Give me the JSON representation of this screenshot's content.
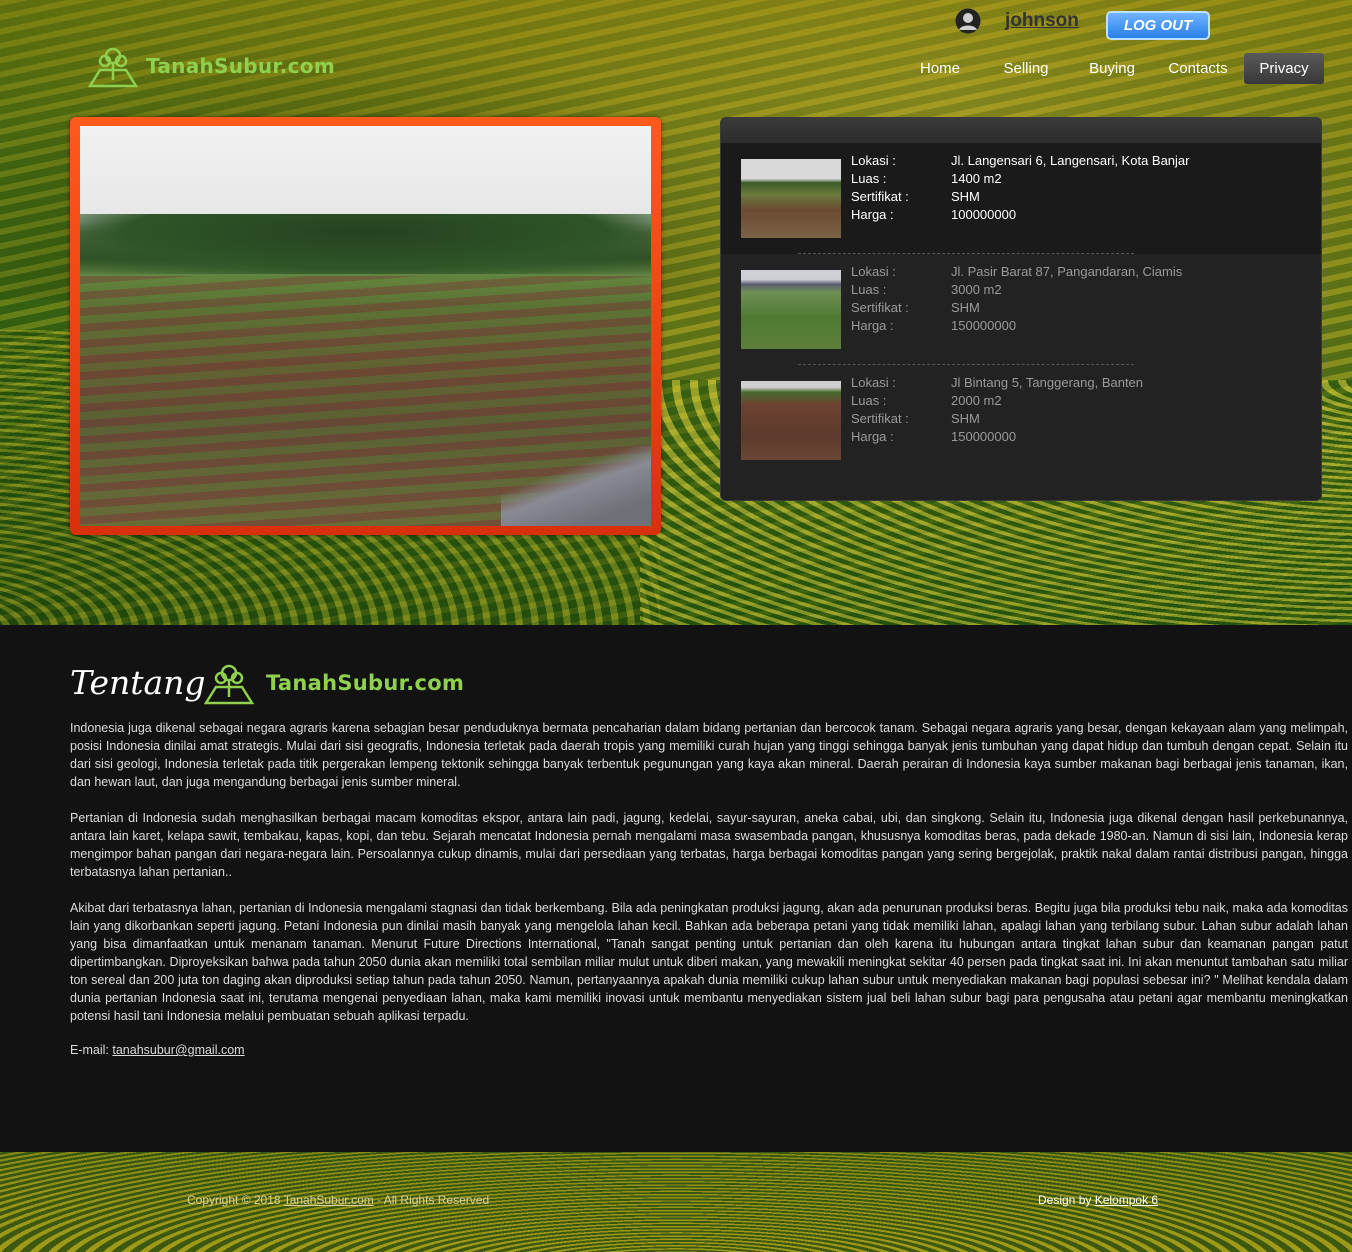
{
  "header": {
    "brand": "TanahSubur.com",
    "username": "johnson",
    "logout_label": "LOG OUT",
    "nav": [
      {
        "label": "Home"
      },
      {
        "label": "Selling"
      },
      {
        "label": "Buying"
      },
      {
        "label": "Contacts"
      },
      {
        "label": "Privacy",
        "active": true
      }
    ]
  },
  "listings": [
    {
      "lokasi_label": "Lokasi :",
      "lokasi": "Jl. Langensari 6, Langensari, Kota Banjar",
      "luas_label": "Luas :",
      "luas": "1400 m2",
      "sertifikat_label": "Sertifikat :",
      "sertifikat": "SHM",
      "harga_label": "Harga :",
      "harga": "100000000"
    },
    {
      "lokasi_label": "Lokasi :",
      "lokasi": "Jl. Pasir Barat 87, Pangandaran, Ciamis",
      "luas_label": "Luas :",
      "luas": "3000 m2",
      "sertifikat_label": "Sertifikat :",
      "sertifikat": "SHM",
      "harga_label": "Harga :",
      "harga": "150000000"
    },
    {
      "lokasi_label": "Lokasi :",
      "lokasi": "Jl Bintang 5, Tanggerang, Banten",
      "luas_label": "Luas :",
      "luas": "2000 m2",
      "sertifikat_label": "Sertifikat :",
      "sertifikat": "SHM",
      "harga_label": "Harga :",
      "harga": "150000000"
    }
  ],
  "about": {
    "title": "Tentang",
    "brand": "TanahSubur.com",
    "paragraphs": [
      "Indonesia juga dikenal sebagai negara agraris karena sebagian besar penduduknya bermata pencaharian dalam bidang pertanian dan bercocok tanam. Sebagai negara agraris yang besar, dengan kekayaan alam yang melimpah, posisi Indonesia dinilai amat strategis. Mulai dari sisi geografis, Indonesia terletak pada daerah tropis yang memiliki curah hujan yang tinggi sehingga banyak jenis tumbuhan yang dapat hidup dan tumbuh dengan cepat. Selain itu dari sisi geologi, Indonesia terletak pada titik pergerakan lempeng tektonik sehingga banyak terbentuk pegunungan yang kaya akan mineral. Daerah perairan di Indonesia kaya sumber makanan bagi berbagai jenis tanaman, ikan, dan hewan laut, dan juga mengandung berbagai jenis sumber mineral.",
      "Pertanian di Indonesia sudah menghasilkan berbagai macam komoditas ekspor, antara lain padi, jagung, kedelai, sayur-sayuran, aneka cabai, ubi, dan singkong. Selain itu, Indonesia juga dikenal dengan hasil perkebunannya, antara lain karet, kelapa sawit, tembakau, kapas, kopi, dan tebu. Sejarah mencatat Indonesia pernah mengalami masa swasembada pangan, khususnya komoditas beras, pada dekade 1980-an. Namun di sisi lain, Indonesia kerap mengimpor bahan pangan dari negara-negara lain. Persoalannya cukup dinamis, mulai dari persediaan yang terbatas, harga berbagai komoditas pangan yang sering bergejolak, praktik nakal dalam rantai distribusi pangan, hingga terbatasnya lahan pertanian..",
      "Akibat dari terbatasnya lahan, pertanian di Indonesia mengalami stagnasi dan tidak berkembang. Bila ada peningkatan produksi jagung, akan ada penurunan produksi beras. Begitu juga bila produksi tebu naik, maka ada komoditas lain yang dikorbankan seperti jagung. Petani Indonesia pun dinilai masih banyak yang mengelola lahan kecil. Bahkan ada beberapa petani yang tidak memiliki lahan, apalagi lahan yang terbilang subur. Lahan subur adalah lahan yang bisa dimanfaatkan untuk menanam tanaman. Menurut Future Directions International, \"Tanah sangat penting untuk pertanian dan oleh karena itu hubungan antara tingkat lahan subur dan keamanan pangan patut dipertimbangkan. Diproyeksikan bahwa pada tahun 2050 dunia akan memiliki total sembilan miliar mulut untuk diberi makan, yang mewakili meningkat sekitar 40 persen pada tingkat saat ini. Ini akan menuntut tambahan satu miliar ton sereal dan 200 juta ton daging akan diproduksi setiap tahun pada tahun 2050. Namun, pertanyaannya apakah dunia memiliki cukup lahan subur untuk menyediakan makanan bagi populasi sebesar ini? \" Melihat kendala dalam dunia pertanian Indonesia saat ini, terutama mengenai penyediaan lahan, maka kami memiliki inovasi untuk membantu menyediakan sistem jual beli lahan subur bagi para pengusaha atau petani agar membantu meningkatkan potensi hasil tani Indonesia melalui pembuatan sebuah aplikasi terpadu."
    ],
    "email_label": "E-mail: ",
    "email": "tanahsubur@gmail.com"
  },
  "footer": {
    "copyright_prefix": "Copyright © 2018 ",
    "copyright_link": "TanahSubur.com",
    "copyright_suffix": " - All Rights Reserved",
    "design_prefix": "Design by ",
    "design_link": "Kelompok 6"
  }
}
